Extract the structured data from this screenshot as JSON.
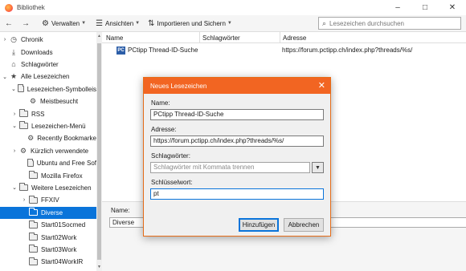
{
  "window": {
    "title": "Bibliothek",
    "controls": [
      "–",
      "□",
      "✕"
    ]
  },
  "toolbar": {
    "back": "←",
    "forward": "→",
    "manage_label": "Verwalten",
    "views_label": "Ansichten",
    "import_label": "Importieren und Sichern",
    "search_placeholder": "Lesezeichen durchsuchen"
  },
  "sidebar": {
    "items": [
      {
        "label": "Chronik",
        "twisty": "›",
        "icon": "clock-icon"
      },
      {
        "label": "Downloads",
        "twisty": "",
        "icon": "download-icon"
      },
      {
        "label": "Schlagwörter",
        "twisty": "",
        "icon": "tag-icon"
      },
      {
        "label": "Alle Lesezeichen",
        "twisty": "⌄",
        "icon": "star-icon"
      },
      {
        "label": "Lesezeichen-Symbolleis",
        "twisty": "⌄",
        "icon": "folder-icon"
      },
      {
        "label": "Meistbesucht",
        "twisty": "",
        "icon": "gear-icon"
      },
      {
        "label": "RSS",
        "twisty": "›",
        "icon": "folder-icon"
      },
      {
        "label": "Lesezeichen-Menü",
        "twisty": "⌄",
        "icon": "folder-icon"
      },
      {
        "label": "Recently Bookmarke",
        "twisty": "",
        "icon": "gear-icon"
      },
      {
        "label": "Kürzlich verwendete",
        "twisty": "›",
        "icon": "gear-icon"
      },
      {
        "label": "Ubuntu and Free Sof",
        "twisty": "",
        "icon": "folder-icon"
      },
      {
        "label": "Mozilla Firefox",
        "twisty": "",
        "icon": "folder-icon"
      },
      {
        "label": "Weitere Lesezeichen",
        "twisty": "⌄",
        "icon": "folder-icon"
      },
      {
        "label": "FFXIV",
        "twisty": "›",
        "icon": "folder-icon"
      },
      {
        "label": "Diverse",
        "twisty": "",
        "icon": "folder-icon",
        "selected": true
      },
      {
        "label": "Start01Socmed",
        "twisty": "",
        "icon": "folder-icon"
      },
      {
        "label": "Start02Work",
        "twisty": "",
        "icon": "folder-icon"
      },
      {
        "label": "Start03Work",
        "twisty": "",
        "icon": "folder-icon"
      },
      {
        "label": "Start04WorkIR",
        "twisty": "",
        "icon": "folder-icon"
      }
    ]
  },
  "list": {
    "columns": [
      "Name",
      "Schlagwörter",
      "Adresse"
    ],
    "rows": [
      {
        "favicon": "PC",
        "name": "PCtipp Thread-ID-Suche",
        "tags": "",
        "address": "https://forum.pctipp.ch/index.php?threads/%s/"
      }
    ]
  },
  "details": {
    "name_label": "Name:",
    "name_value": "Diverse"
  },
  "dialog": {
    "title": "Neues Lesezeichen",
    "name_label": "Name:",
    "name_value": "PCtipp Thread-ID-Suche",
    "address_label": "Adresse:",
    "address_value": "https://forum.pctipp.ch/index.php?threads/%s/",
    "tags_label": "Schlagwörter:",
    "tags_placeholder": "Schlagwörter mit Kommata trennen",
    "keyword_label": "Schlüsselwort:",
    "keyword_value": "pt",
    "add_button": "Hinzufügen",
    "cancel_button": "Abbrechen"
  },
  "colors": {
    "accent": "#0a74da",
    "dialog_title": "#f26522"
  }
}
